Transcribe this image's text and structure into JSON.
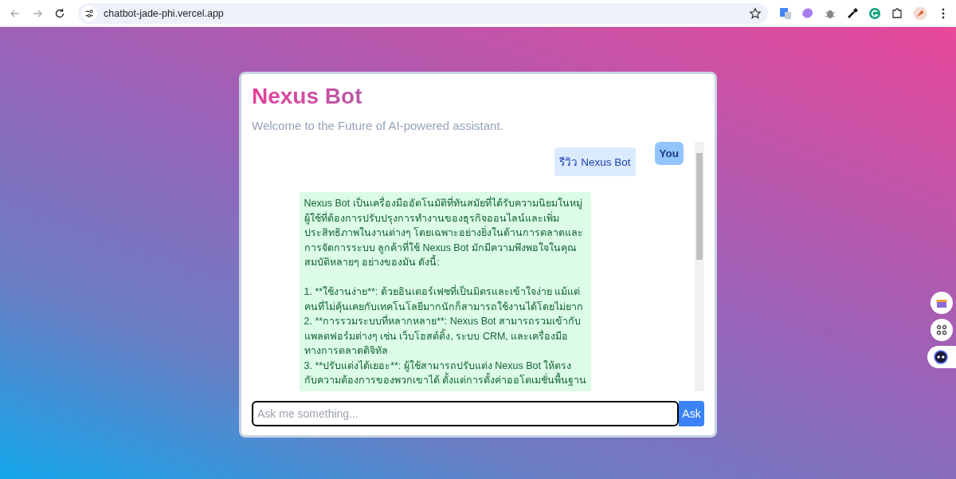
{
  "browser": {
    "url": "chatbot-jade-phi.vercel.app"
  },
  "chat": {
    "title": "Nexus Bot",
    "subtitle": "Welcome to the Future of AI-powered assistant.",
    "messages": [
      {
        "kind": "user",
        "sender": "You",
        "lines": [
          "รีวิว Nexus Bot"
        ]
      },
      {
        "kind": "bot",
        "lines": [
          "Nexus Bot เป็นเครื่องมืออัตโนมัติที่ทันสมัยที่ได้รับความนิยมในหมู่",
          "ผู้ใช้ที่ต้องการปรับปรุงการทำงานของธุรกิจออนไลน์และเพิ่ม",
          "ประสิทธิภาพในงานต่างๆ โดยเฉพาะอย่างยิ่งในด้านการตลาดและ",
          "การจัดการระบบ ลูกค้าที่ใช้ Nexus Bot มักมีความพึงพอใจในคุณ",
          "สมบัติหลายๆ อย่างของมัน ดังนี้:"
        ],
        "lines_after_break": [
          "1. **ใช้งานง่าย**: ด้วยอินเตอร์เฟซที่เป็นมิตรและเข้าใจง่าย แม้แต่",
          "คนที่ไม่คุ้นเคยกับเทคโนโลยีมากนักก็สามารถใช้งานได้โดยไม่ยาก",
          "2. **การรวมระบบที่หลากหลาย**: Nexus Bot สามารถรวมเข้ากับ",
          "แพลตฟอร์มต่างๆ เช่น เว็บโฮสต์ติ้ง, ระบบ CRM, และเครื่องมือ",
          "ทางการตลาดดิจิทัล",
          "3. **ปรับแต่งได้เยอะ**: ผู้ใช้สามารถปรับแต่ง Nexus Bot ให้ตรง",
          "กับความต้องการของพวกเขาได้ ตั้งแต่การตั้งค่าออโตเมชั่นพื้นฐาน"
        ]
      }
    ],
    "input": {
      "placeholder": "Ask me something..."
    },
    "send_button": "Ask"
  }
}
